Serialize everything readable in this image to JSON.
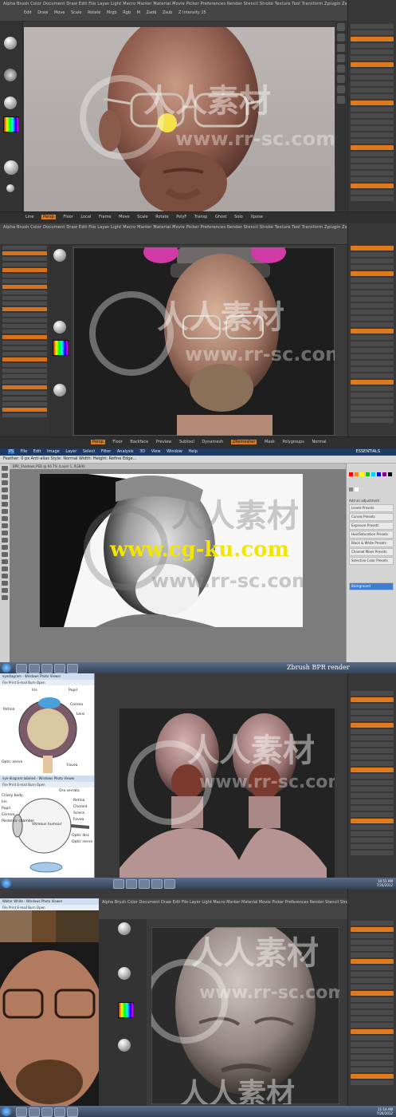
{
  "watermark": {
    "brand_text": "人人素材",
    "url_text": "www.rr-sc.com",
    "overlay_url": "www.cg-ku.com"
  },
  "panel1": {
    "title": "ZBrush",
    "menu": "Alpha  Brush  Color  Document  Draw  Edit  File  Layer  Light  Macro  Marker  Material  Movie  Picker  Preferences  Render  Stencil  Stroke  Texture  Tool  Transform  Zplugin  Zscript",
    "top_buttons": [
      "Edit",
      "Draw",
      "Move",
      "Scale",
      "Rotate",
      "Mrgb",
      "Rgb",
      "M",
      "Zadd",
      "Zsub",
      "Z Intensity 25"
    ],
    "bottom_buttons": [
      "Line",
      "Persp",
      "Floor",
      "Local",
      "Frame",
      "Move",
      "Scale",
      "Rotate",
      "PolyF",
      "Transp",
      "Ghost",
      "Solo",
      "Xpose"
    ]
  },
  "panel2": {
    "bottom_buttons": [
      "Persp",
      "Floor",
      "Backface",
      "Preview",
      "Subtool",
      "Dynamesh",
      "ZRemesher",
      "Mask",
      "Polygroups",
      "Normal"
    ]
  },
  "panel3": {
    "menu": [
      "PS",
      "File",
      "Edit",
      "Image",
      "Layer",
      "Select",
      "Filter",
      "Analysis",
      "3D",
      "View",
      "Window",
      "Help"
    ],
    "options": "Feather: 0 px   Anti-alias   Style: Normal   Width:   Height:   Refine Edge...",
    "doc_tab": "BPR_Shadows.PSD @ 66.7% (Layer 1, RGB/8)",
    "right_header": "ESSENTIALS",
    "adjust_label": "Add an adjustment",
    "layers": [
      "Levels Presets",
      "Curves Presets",
      "Exposure Presets",
      "Hue/Saturation Presets",
      "Black & White Presets",
      "Channel Mixer Presets",
      "Selective Color Presets"
    ],
    "selected_layer": "Background"
  },
  "panel4": {
    "photo_viewer_title": "eyediagram - Windows Photo Viewer",
    "viewer_menu": "File  Print  E-mail  Burn  Open",
    "second_viewer_title": "eye-diagram-labeled - Windows Photo Viewer",
    "eye_labels": [
      "Iris",
      "Pupil",
      "Retina",
      "Cornea",
      "Lens",
      "Optic nerve",
      "Fovea"
    ],
    "eye_labels_2": [
      "Ora serrata",
      "Ciliary body",
      "Iris",
      "Pupil",
      "Cornea",
      "Posterior chamber",
      "Vitreous humour",
      "Retina",
      "Choroid",
      "Sclera",
      "Fovea",
      "Optic disc",
      "Optic nerve"
    ],
    "window_title": "Zbrush BPR render",
    "taskbar_time": "10:51 AM",
    "taskbar_date": "7/26/2012"
  },
  "panel5": {
    "photo_viewer_title": "Walter White - Windows Photo Viewer",
    "viewer_menu": "File  Print  E-mail  Burn  Open",
    "taskbar_time": "11:14 AM",
    "taskbar_date": "7/26/2012"
  },
  "colors": {
    "zbrush_orange": "#e07a1e",
    "zbrush_bg": "#3b3b3b",
    "ps_blue": "#1f3b63",
    "overlay_yellow": "#f2e600"
  }
}
